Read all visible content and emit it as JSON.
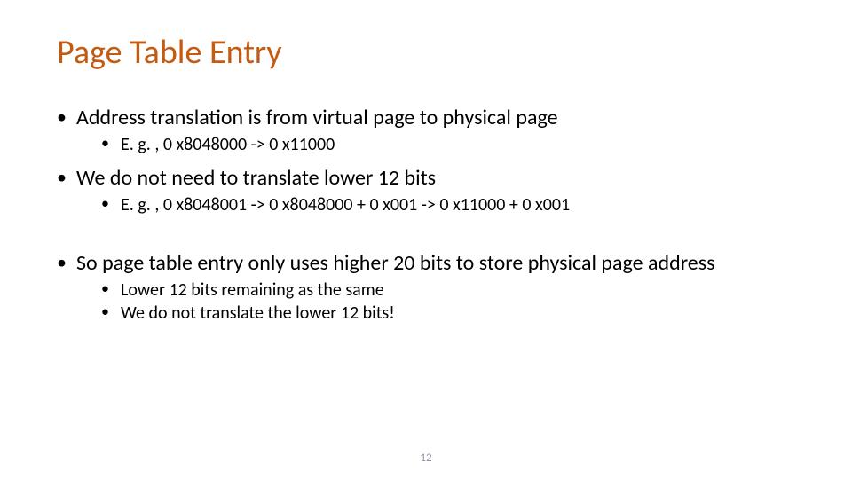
{
  "title": "Page Table Entry",
  "bullets": {
    "b1": "Address translation is from virtual page to physical page",
    "b1_sub1": "E. g. , 0 x8048000 -> 0 x11000",
    "b2": "We do not need to translate lower 12 bits",
    "b2_sub1": "E. g. , 0 x8048001 -> 0 x8048000 + 0 x001 -> 0 x11000 + 0 x001",
    "b3": "So page table entry only uses higher 20 bits to store physical page address",
    "b3_sub1": "Lower 12 bits remaining as the same",
    "b3_sub2": "We do not translate the lower 12 bits!"
  },
  "page_number": "12"
}
